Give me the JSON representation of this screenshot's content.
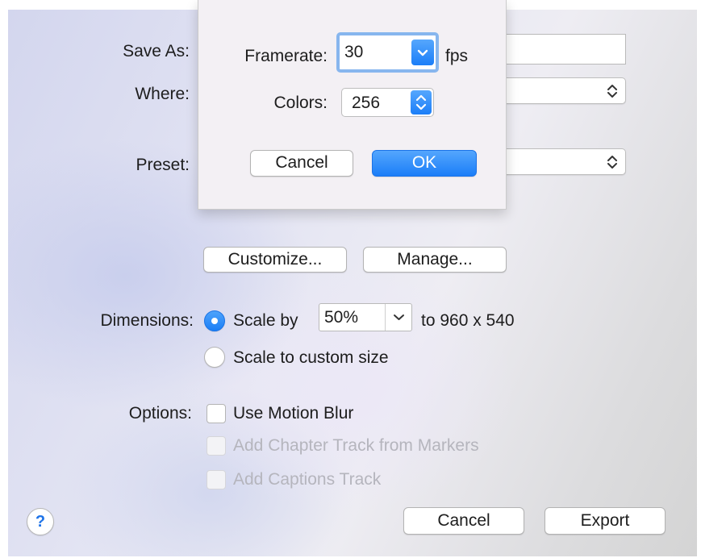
{
  "export": {
    "save_as_label": "Save As:",
    "save_as_value": "",
    "where_label": "Where:",
    "where_value": "",
    "preset_label": "Preset:",
    "preset_value": "",
    "customize_button": "Customize...",
    "manage_button": "Manage...",
    "dimensions_label": "Dimensions:",
    "scale_by_label": "Scale by",
    "scale_value": "50%",
    "scale_result": "to 960 x 540",
    "scale_custom_label": "Scale to custom size",
    "options_label": "Options:",
    "motion_blur_label": "Use Motion Blur",
    "chapter_track_label": "Add Chapter Track from Markers",
    "captions_track_label": "Add Captions Track",
    "help_label": "?",
    "cancel_button": "Cancel",
    "export_button": "Export"
  },
  "sheet": {
    "framerate_label": "Framerate:",
    "framerate_value": "30",
    "fps_label": "fps",
    "colors_label": "Colors:",
    "colors_value": "256",
    "cancel_button": "Cancel",
    "ok_button": "OK"
  },
  "colors": {
    "accent": "#1b7ef8",
    "focus_ring": "#87b6ee",
    "disabled_text": "#b5b5bd"
  },
  "icons": {
    "popup_chevron": "updown-chevron-icon",
    "combo_arrow": "chevron-down-icon"
  }
}
